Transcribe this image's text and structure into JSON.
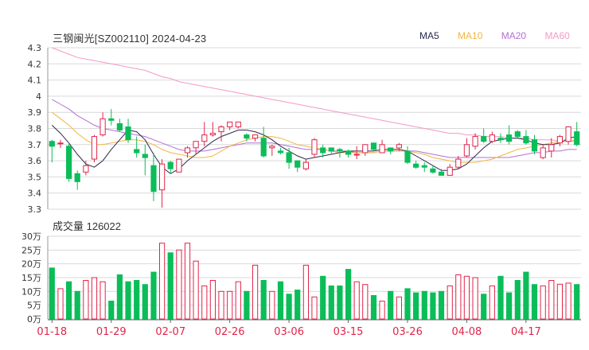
{
  "title": "三钢闽光[SZ002110] 2024-04-23",
  "legend": [
    {
      "label": "MA5",
      "color": "#2b2b4f"
    },
    {
      "label": "MA10",
      "color": "#f2b643"
    },
    {
      "label": "MA20",
      "color": "#b46fd6"
    },
    {
      "label": "MA60",
      "color": "#f29ac6"
    }
  ],
  "volume_label": "成交量 126022",
  "colors": {
    "up": "#e0254a",
    "down": "#0bbd59",
    "grid": "#d9d9d9",
    "axis_text": "#333333",
    "date_text": "#e0254a"
  },
  "chart_data": [
    {
      "type": "candlestick",
      "y_ticks": [
        "4.3",
        "4.2",
        "4.1",
        "4",
        "3.9",
        "3.8",
        "3.7",
        "3.6",
        "3.5",
        "3.4",
        "3.3"
      ],
      "ylim": [
        3.3,
        4.3
      ],
      "x_ticks": [
        {
          "label": "01-18",
          "index": 0
        },
        {
          "label": "01-29",
          "index": 7
        },
        {
          "label": "02-07",
          "index": 14
        },
        {
          "label": "02-26",
          "index": 21
        },
        {
          "label": "03-06",
          "index": 28
        },
        {
          "label": "03-15",
          "index": 35
        },
        {
          "label": "03-26",
          "index": 42
        },
        {
          "label": "04-08",
          "index": 49
        },
        {
          "label": "04-17",
          "index": 56
        }
      ],
      "candles": [
        [
          3.72,
          3.69,
          3.73,
          3.59
        ],
        [
          3.71,
          3.71,
          3.73,
          3.68
        ],
        [
          3.69,
          3.49,
          3.71,
          3.47
        ],
        [
          3.52,
          3.47,
          3.54,
          3.42
        ],
        [
          3.53,
          3.57,
          3.6,
          3.51
        ],
        [
          3.61,
          3.75,
          3.76,
          3.59
        ],
        [
          3.76,
          3.86,
          3.9,
          3.75
        ],
        [
          3.86,
          3.85,
          3.92,
          3.82
        ],
        [
          3.83,
          3.79,
          3.86,
          3.78
        ],
        [
          3.81,
          3.73,
          3.86,
          3.71
        ],
        [
          3.67,
          3.65,
          3.75,
          3.62
        ],
        [
          3.64,
          3.62,
          3.7,
          3.51
        ],
        [
          3.57,
          3.41,
          3.65,
          3.35
        ],
        [
          3.42,
          3.58,
          3.61,
          3.31
        ],
        [
          3.59,
          3.55,
          3.6,
          3.52
        ],
        [
          3.53,
          3.61,
          3.61,
          3.53
        ],
        [
          3.65,
          3.68,
          3.69,
          3.62
        ],
        [
          3.68,
          3.72,
          3.72,
          3.64
        ],
        [
          3.72,
          3.76,
          3.84,
          3.69
        ],
        [
          3.76,
          3.77,
          3.84,
          3.75
        ],
        [
          3.78,
          3.81,
          3.82,
          3.72
        ],
        [
          3.81,
          3.84,
          3.84,
          3.79
        ],
        [
          3.81,
          3.84,
          3.84,
          3.8
        ],
        [
          3.76,
          3.74,
          3.77,
          3.72
        ],
        [
          3.74,
          3.76,
          3.76,
          3.72
        ],
        [
          3.74,
          3.63,
          3.81,
          3.62
        ],
        [
          3.68,
          3.69,
          3.7,
          3.63
        ],
        [
          3.66,
          3.65,
          3.68,
          3.64
        ],
        [
          3.65,
          3.59,
          3.68,
          3.55
        ],
        [
          3.6,
          3.56,
          3.6,
          3.53
        ],
        [
          3.55,
          3.59,
          3.61,
          3.54
        ],
        [
          3.64,
          3.73,
          3.74,
          3.62
        ],
        [
          3.68,
          3.65,
          3.7,
          3.62
        ],
        [
          3.68,
          3.66,
          3.68,
          3.64
        ],
        [
          3.67,
          3.66,
          3.68,
          3.62
        ],
        [
          3.66,
          3.64,
          3.67,
          3.62
        ],
        [
          3.64,
          3.64,
          3.69,
          3.61
        ],
        [
          3.65,
          3.7,
          3.7,
          3.63
        ],
        [
          3.71,
          3.67,
          3.71,
          3.66
        ],
        [
          3.65,
          3.7,
          3.73,
          3.65
        ],
        [
          3.68,
          3.66,
          3.68,
          3.64
        ],
        [
          3.68,
          3.7,
          3.71,
          3.66
        ],
        [
          3.66,
          3.59,
          3.69,
          3.58
        ],
        [
          3.58,
          3.56,
          3.6,
          3.55
        ],
        [
          3.57,
          3.56,
          3.59,
          3.53
        ],
        [
          3.55,
          3.53,
          3.57,
          3.52
        ],
        [
          3.53,
          3.51,
          3.55,
          3.51
        ],
        [
          3.51,
          3.56,
          3.58,
          3.51
        ],
        [
          3.56,
          3.61,
          3.63,
          3.55
        ],
        [
          3.63,
          3.7,
          3.74,
          3.62
        ],
        [
          3.69,
          3.75,
          3.77,
          3.67
        ],
        [
          3.75,
          3.72,
          3.8,
          3.71
        ],
        [
          3.72,
          3.76,
          3.78,
          3.71
        ],
        [
          3.74,
          3.73,
          3.77,
          3.71
        ],
        [
          3.76,
          3.72,
          3.82,
          3.7
        ],
        [
          3.78,
          3.75,
          3.79,
          3.74
        ],
        [
          3.75,
          3.71,
          3.79,
          3.7
        ],
        [
          3.73,
          3.66,
          3.76,
          3.64
        ],
        [
          3.62,
          3.68,
          3.7,
          3.61
        ],
        [
          3.66,
          3.7,
          3.74,
          3.62
        ],
        [
          3.71,
          3.75,
          3.76,
          3.69
        ],
        [
          3.72,
          3.81,
          3.81,
          3.7
        ],
        [
          3.78,
          3.7,
          3.84,
          3.69
        ]
      ],
      "ma": {
        "MA5": [
          3.82,
          3.77,
          3.71,
          3.64,
          3.58,
          3.56,
          3.6,
          3.67,
          3.73,
          3.79,
          3.78,
          3.73,
          3.64,
          3.56,
          3.52,
          3.55,
          3.6,
          3.64,
          3.68,
          3.72,
          3.75,
          3.77,
          3.79,
          3.79,
          3.78,
          3.76,
          3.73,
          3.69,
          3.66,
          3.63,
          3.61,
          3.62,
          3.63,
          3.64,
          3.65,
          3.66,
          3.66,
          3.66,
          3.66,
          3.67,
          3.67,
          3.67,
          3.66,
          3.63,
          3.6,
          3.57,
          3.54,
          3.54,
          3.55,
          3.58,
          3.63,
          3.68,
          3.72,
          3.73,
          3.74,
          3.74,
          3.73,
          3.71,
          3.7,
          3.7,
          3.71,
          3.74,
          3.75
        ],
        "MA10": [
          3.9,
          3.86,
          3.82,
          3.77,
          3.73,
          3.7,
          3.7,
          3.71,
          3.72,
          3.73,
          3.73,
          3.72,
          3.7,
          3.67,
          3.65,
          3.64,
          3.63,
          3.62,
          3.62,
          3.63,
          3.66,
          3.69,
          3.71,
          3.73,
          3.74,
          3.75,
          3.75,
          3.74,
          3.72,
          3.7,
          3.69,
          3.68,
          3.67,
          3.66,
          3.65,
          3.65,
          3.65,
          3.65,
          3.65,
          3.66,
          3.66,
          3.66,
          3.66,
          3.65,
          3.64,
          3.62,
          3.61,
          3.6,
          3.59,
          3.59,
          3.59,
          3.6,
          3.61,
          3.63,
          3.65,
          3.67,
          3.68,
          3.69,
          3.7,
          3.71,
          3.72,
          3.72,
          3.73
        ],
        "MA20": [
          3.98,
          3.95,
          3.92,
          3.88,
          3.85,
          3.82,
          3.8,
          3.79,
          3.78,
          3.77,
          3.76,
          3.75,
          3.73,
          3.71,
          3.69,
          3.67,
          3.66,
          3.66,
          3.66,
          3.67,
          3.68,
          3.69,
          3.7,
          3.71,
          3.71,
          3.71,
          3.71,
          3.7,
          3.69,
          3.68,
          3.67,
          3.67,
          3.67,
          3.66,
          3.66,
          3.66,
          3.65,
          3.65,
          3.65,
          3.66,
          3.66,
          3.66,
          3.66,
          3.66,
          3.65,
          3.64,
          3.63,
          3.62,
          3.62,
          3.62,
          3.62,
          3.62,
          3.62,
          3.62,
          3.62,
          3.63,
          3.64,
          3.65,
          3.65,
          3.66,
          3.66,
          3.67,
          3.67
        ],
        "MA60": [
          4.3,
          4.28,
          4.26,
          4.24,
          4.23,
          4.22,
          4.21,
          4.2,
          4.19,
          4.18,
          4.17,
          4.16,
          4.14,
          4.12,
          4.11,
          4.09,
          4.08,
          4.07,
          4.06,
          4.05,
          4.04,
          4.03,
          4.02,
          4.01,
          4.0,
          3.99,
          3.98,
          3.97,
          3.96,
          3.95,
          3.94,
          3.93,
          3.92,
          3.91,
          3.9,
          3.89,
          3.88,
          3.87,
          3.86,
          3.85,
          3.84,
          3.83,
          3.82,
          3.81,
          3.8,
          3.79,
          3.78,
          3.77,
          3.77,
          3.76,
          3.76,
          3.75,
          3.75,
          3.75,
          3.74,
          3.74,
          3.74,
          3.73,
          3.73,
          3.73,
          3.72,
          3.72,
          3.72
        ]
      }
    },
    {
      "type": "bar",
      "title": "成交量",
      "y_ticks": [
        "30万",
        "25万",
        "20万",
        "15万",
        "10万",
        "5万",
        "0万"
      ],
      "ylim": [
        0,
        300000
      ],
      "values": [
        185000,
        110000,
        135000,
        100000,
        140000,
        150000,
        135000,
        65000,
        160000,
        135000,
        140000,
        125000,
        170000,
        275000,
        240000,
        250000,
        275000,
        210000,
        120000,
        140000,
        100000,
        100000,
        135000,
        100000,
        195000,
        140000,
        100000,
        135000,
        90000,
        105000,
        195000,
        80000,
        155000,
        120000,
        120000,
        180000,
        135000,
        125000,
        85000,
        65000,
        100000,
        80000,
        110000,
        95000,
        100000,
        95000,
        100000,
        120000,
        160000,
        155000,
        150000,
        90000,
        120000,
        155000,
        95000,
        140000,
        170000,
        125000,
        120000,
        140000,
        126022,
        130000,
        125000
      ]
    }
  ]
}
